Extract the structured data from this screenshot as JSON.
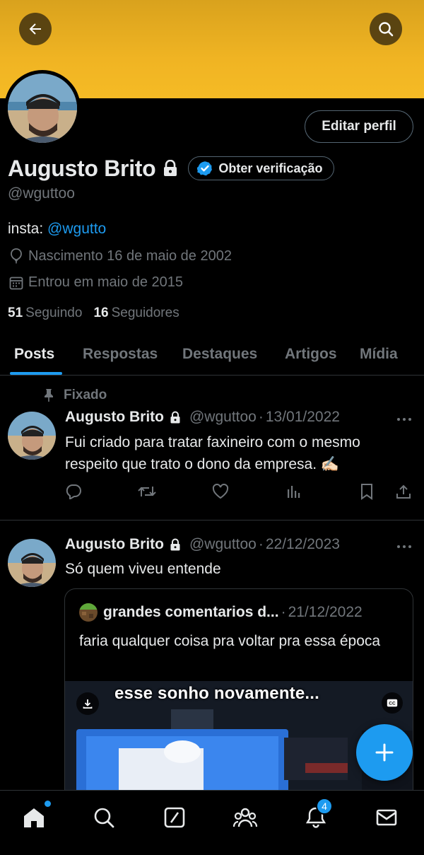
{
  "profile": {
    "display_name": "Augusto Brito",
    "handle": "@wguttoo",
    "edit_label": "Editar perfil",
    "verify_label": "Obter verificação",
    "bio_prefix": "insta: ",
    "bio_link": "@wgutto",
    "birth": "Nascimento 16 de maio de 2002",
    "joined": "Entrou em maio de 2015",
    "following_count": "51",
    "following_label": "Seguindo",
    "followers_count": "16",
    "followers_label": "Seguidores"
  },
  "tabs": [
    {
      "label": "Posts",
      "active": true
    },
    {
      "label": "Respostas",
      "active": false
    },
    {
      "label": "Destaques",
      "active": false
    },
    {
      "label": "Artigos",
      "active": false
    },
    {
      "label": "Mídia",
      "active": false
    }
  ],
  "tweets": [
    {
      "pinned_label": "Fixado",
      "name": "Augusto Brito",
      "handle": "@wguttoo",
      "separator": "·",
      "date": "13/01/2022",
      "text": "Fui criado para tratar faxineiro com o mesmo respeito que trato o dono da empresa. ✍🏻"
    },
    {
      "name": "Augusto Brito",
      "handle": "@wguttoo",
      "separator": "·",
      "date": "22/12/2023",
      "text": "Só quem viveu entende",
      "quote": {
        "name": "grandes comentarios d...",
        "separator": "·",
        "date": "21/12/2022",
        "text": "faria qualquer coisa pra voltar pra essa época",
        "media_caption": "esse sonho novamente..."
      }
    }
  ],
  "nav": {
    "notifications_badge": "4"
  },
  "icons": {
    "back": "arrow-left-icon",
    "search": "search-icon",
    "lock": "lock-icon",
    "verified": "verified-badge-icon",
    "birth": "balloon-icon",
    "calendar": "calendar-icon",
    "pin": "pin-icon",
    "reply": "reply-icon",
    "retweet": "retweet-icon",
    "like": "heart-icon",
    "views": "views-icon",
    "bookmark": "bookmark-icon",
    "share": "share-icon",
    "compose": "plus-icon"
  },
  "colors": {
    "accent": "#1d9bf0",
    "banner": "#f0b423",
    "background": "#000000",
    "muted": "#71767b"
  }
}
